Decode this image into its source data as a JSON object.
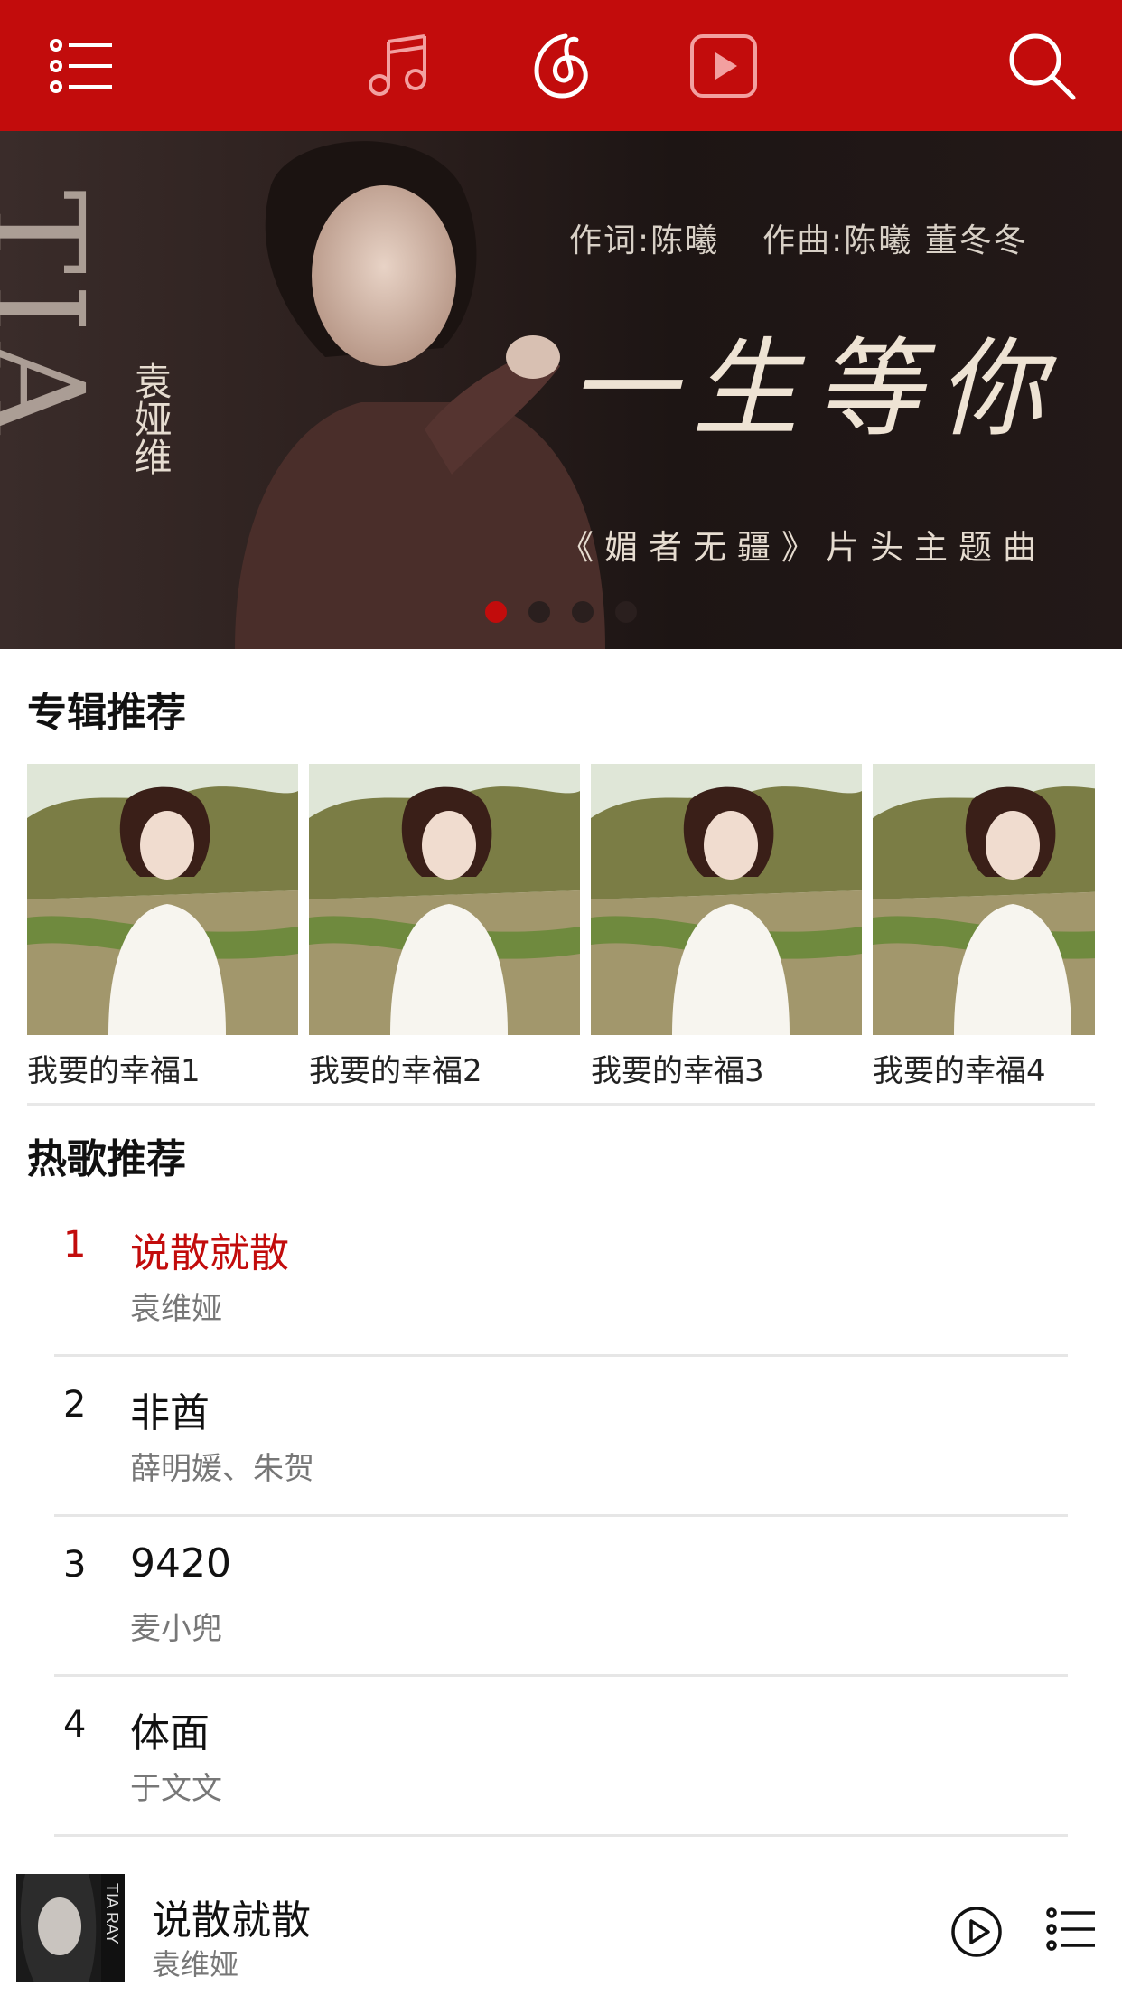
{
  "topbar": {
    "background": "#c20c0c",
    "icons": [
      "menu-icon",
      "music-note-icon",
      "netease-logo-icon",
      "video-play-icon",
      "search-icon"
    ]
  },
  "banner": {
    "side_text": "TIA",
    "singer": "袁娅维",
    "lyrics_credit": "作词:陈曦",
    "music_credit": "作曲:陈曦  董冬冬",
    "song_title": "一生等你",
    "subtitle": "《媚者无疆》片头主题曲",
    "slides": 4,
    "active_slide": 1
  },
  "albums_section": {
    "title": "专辑推荐",
    "albums": [
      {
        "name": "我要的幸福1"
      },
      {
        "name": "我要的幸福2"
      },
      {
        "name": "我要的幸福3"
      },
      {
        "name": "我要的幸福4"
      }
    ]
  },
  "hot_section": {
    "title": "热歌推荐",
    "songs": [
      {
        "index": "1",
        "title": "说散就散",
        "artist": "袁维娅",
        "current": true
      },
      {
        "index": "2",
        "title": "非酋",
        "artist": "薛明媛、朱贺",
        "current": false
      },
      {
        "index": "3",
        "title": "9420",
        "artist": "麦小兜",
        "current": false
      },
      {
        "index": "4",
        "title": "体面",
        "artist": "于文文",
        "current": false
      }
    ]
  },
  "player": {
    "title": "说散就散",
    "artist": "袁维娅",
    "accent": "#c20c0c"
  }
}
